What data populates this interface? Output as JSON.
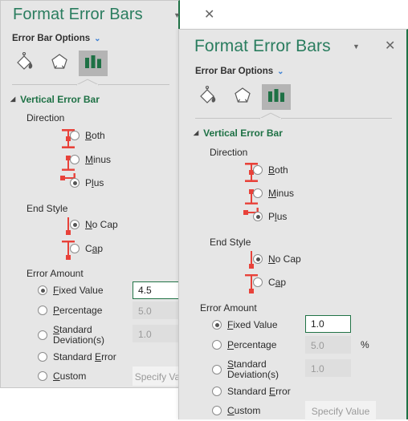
{
  "panels": [
    {
      "id": "panel-1",
      "title": "Format Error Bars",
      "options_label": "Error Bar Options",
      "chevron_icon": "▼",
      "close_icon": "✕",
      "caret_icon": "⌄",
      "tabs": [
        {
          "name": "fill-line-icon",
          "label": "Fill & Line",
          "selected": false
        },
        {
          "name": "effects-icon",
          "label": "Effects",
          "selected": false
        },
        {
          "name": "error-bar-options-icon",
          "label": "Error Bar Options",
          "selected": true
        }
      ],
      "section": {
        "label": "Vertical Error Bar",
        "triangle": "◢",
        "expanded": true
      },
      "direction": {
        "label": "Direction",
        "options": [
          {
            "label": "Both",
            "accel": "B",
            "checked": false,
            "icon": "error-bar-both-icon"
          },
          {
            "label": "Minus",
            "accel": "M",
            "checked": false,
            "icon": "error-bar-minus-icon"
          },
          {
            "label": "Plus",
            "accel": "l",
            "checked": true,
            "icon": "error-bar-plus-icon"
          }
        ]
      },
      "end_style": {
        "label": "End Style",
        "options": [
          {
            "label": "No Cap",
            "accel": "N",
            "checked": true,
            "icon": "error-bar-no-cap-icon"
          },
          {
            "label": "Cap",
            "accel": "a",
            "checked": false,
            "icon": "error-bar-cap-icon"
          }
        ]
      },
      "error_amount": {
        "label": "Error Amount",
        "options": [
          {
            "label": "Fixed Value",
            "accel": "F",
            "checked": true,
            "value": "4.5",
            "state": "active"
          },
          {
            "label": "Percentage",
            "accel": "P",
            "checked": false,
            "value": "5.0",
            "state": "disabled",
            "suffix": ""
          },
          {
            "label": "Standard Deviation(s)",
            "accel": "S",
            "checked": false,
            "value": "1.0",
            "state": "disabled"
          },
          {
            "label": "Standard Error",
            "accel": "E",
            "checked": false,
            "value": null,
            "state": "none"
          },
          {
            "label": "Custom",
            "accel": "C",
            "checked": false,
            "value": "Specify Value",
            "state": "specify"
          }
        ]
      }
    },
    {
      "id": "panel-2",
      "title": "Format Error Bars",
      "options_label": "Error Bar Options",
      "chevron_icon": "▼",
      "close_icon": "✕",
      "caret_icon": "⌄",
      "tabs": [
        {
          "name": "fill-line-icon",
          "label": "Fill & Line",
          "selected": false
        },
        {
          "name": "effects-icon",
          "label": "Effects",
          "selected": false
        },
        {
          "name": "error-bar-options-icon",
          "label": "Error Bar Options",
          "selected": true
        }
      ],
      "section": {
        "label": "Vertical Error Bar",
        "triangle": "◢",
        "expanded": true
      },
      "direction": {
        "label": "Direction",
        "options": [
          {
            "label": "Both",
            "accel": "B",
            "checked": false,
            "icon": "error-bar-both-icon"
          },
          {
            "label": "Minus",
            "accel": "M",
            "checked": false,
            "icon": "error-bar-minus-icon"
          },
          {
            "label": "Plus",
            "accel": "l",
            "checked": true,
            "icon": "error-bar-plus-icon"
          }
        ]
      },
      "end_style": {
        "label": "End Style",
        "options": [
          {
            "label": "No Cap",
            "accel": "N",
            "checked": true,
            "icon": "error-bar-no-cap-icon"
          },
          {
            "label": "Cap",
            "accel": "a",
            "checked": false,
            "icon": "error-bar-cap-icon"
          }
        ]
      },
      "error_amount": {
        "label": "Error Amount",
        "options": [
          {
            "label": "Fixed Value",
            "accel": "F",
            "checked": true,
            "value": "1.0",
            "state": "active"
          },
          {
            "label": "Percentage",
            "accel": "P",
            "checked": false,
            "value": "5.0",
            "state": "disabled",
            "suffix": "%"
          },
          {
            "label": "Standard Deviation(s)",
            "accel": "S",
            "checked": false,
            "value": "1.0",
            "state": "disabled"
          },
          {
            "label": "Standard Error",
            "accel": "E",
            "checked": false,
            "value": null,
            "state": "none"
          },
          {
            "label": "Custom",
            "accel": "C",
            "checked": false,
            "value": "Specify Value",
            "state": "specify"
          }
        ]
      }
    }
  ],
  "colors": {
    "accent_green": "#1e7145",
    "title_green": "#2a7d5f",
    "panel_bg": "#e6e6e6",
    "error_bar_red": "#e8423a",
    "link_blue": "#3b7fd4"
  }
}
